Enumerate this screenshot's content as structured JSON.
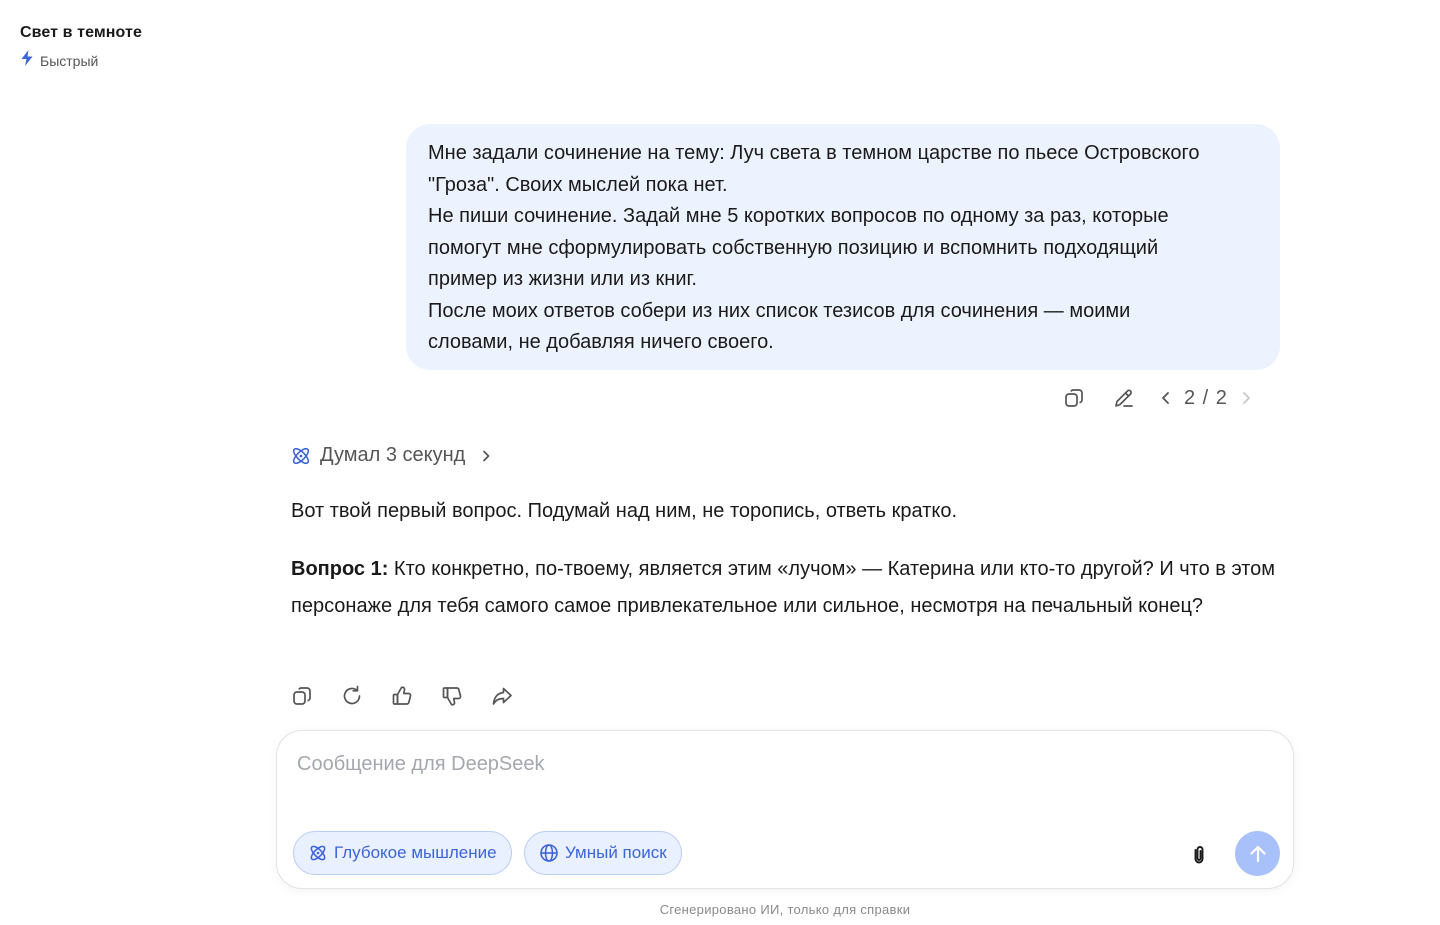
{
  "header": {
    "chat_title": "Свет в темноте",
    "model_label": "Быстрый"
  },
  "user_message": {
    "lines": [
      "Мне задали сочинение на тему: Луч света в темном царстве по пьесе Островского",
      "\"Гроза\". Своих мыслей пока нет.",
      "Не пиши сочинение. Задай мне 5 коротких вопросов по одному за раз, которые",
      "помогут мне сформулировать собственную позицию и вспомнить подходящий",
      "пример из жизни или из книг.",
      "После моих ответов собери из них список тезисов для сочинения — моими",
      "словами, не добавляя ничего своего."
    ],
    "pager": "2 / 2"
  },
  "assistant": {
    "thinking_label": "Думал 3 секунд",
    "intro": "Вот твой первый вопрос. Подумай над ним, не торопись, ответь кратко.",
    "question_label": "Вопрос 1:",
    "question_text": " Кто конкретно, по-твоему, является этим «лучом» — Катерина или кто-то другой? И что в этом персонаже для тебя самого самое привлекательное или сильное, несмотря на печальный конец?"
  },
  "composer": {
    "placeholder": "Сообщение для DeepSeek",
    "deep_think_label": "Глубокое мышление",
    "smart_search_label": "Умный поиск"
  },
  "footer": {
    "note": "Сгенерировано ИИ, только для справки"
  },
  "colors": {
    "accent": "#3d64d8",
    "user_bubble_bg": "#edf3fe",
    "send_button_bg": "#a9c1fa"
  },
  "icons": {
    "model": "lightning-icon",
    "thinking": "atom-icon",
    "deep_think": "atom-icon",
    "smart_search": "globe-icon",
    "attach": "paperclip-icon",
    "send": "arrow-up-icon"
  }
}
